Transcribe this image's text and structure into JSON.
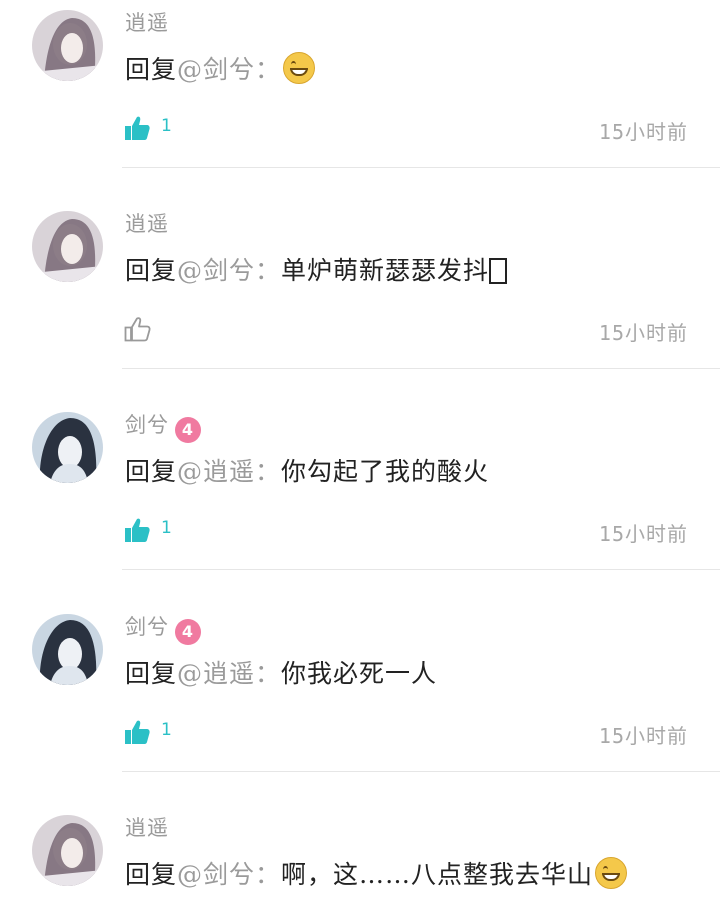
{
  "comments": [
    {
      "username": "逍遥",
      "reply_prefix": "回复",
      "mention": "@剑兮",
      "separator": "：",
      "body": "",
      "likes": "1",
      "liked": true,
      "time": "15小时前",
      "avatar": "xiaoyao",
      "emoji": true,
      "tofu": false,
      "level": null
    },
    {
      "username": "逍遥",
      "reply_prefix": "回复",
      "mention": "@剑兮",
      "separator": "：",
      "body": "单炉萌新瑟瑟发抖",
      "likes": "",
      "liked": false,
      "time": "15小时前",
      "avatar": "xiaoyao",
      "emoji": false,
      "tofu": true,
      "level": null
    },
    {
      "username": "剑兮",
      "reply_prefix": "回复",
      "mention": "@逍遥",
      "separator": "：",
      "body": "你勾起了我的酸火",
      "likes": "1",
      "liked": true,
      "time": "15小时前",
      "avatar": "jianxi",
      "emoji": false,
      "tofu": false,
      "level": "4"
    },
    {
      "username": "剑兮",
      "reply_prefix": "回复",
      "mention": "@逍遥",
      "separator": "：",
      "body": "你我必死一人",
      "likes": "1",
      "liked": true,
      "time": "15小时前",
      "avatar": "jianxi",
      "emoji": false,
      "tofu": false,
      "level": "4"
    },
    {
      "username": "逍遥",
      "reply_prefix": "回复",
      "mention": "@剑兮",
      "separator": "：",
      "body": "啊，这……八点整我去华山",
      "likes": null,
      "liked": false,
      "time": null,
      "avatar": "xiaoyao",
      "emoji": true,
      "tofu": false,
      "level": null
    }
  ],
  "colors": {
    "like_active": "#2bc0c6",
    "like_inactive": "#9a9a9a",
    "level_badge": "#f07aa0",
    "divider": "#e6e6e6"
  }
}
